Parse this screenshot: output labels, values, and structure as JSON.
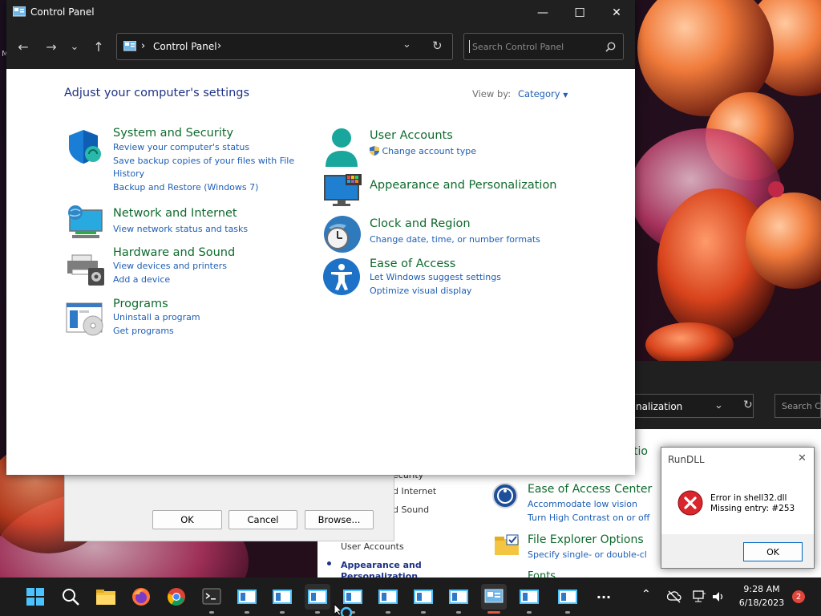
{
  "window": {
    "title": "Control Panel",
    "minimize": "—",
    "maximize": "☐",
    "close": "✕"
  },
  "nav": {
    "back": "←",
    "forward": "→",
    "recent": "⌄",
    "up": "↑",
    "breadcrumb_sep": "›",
    "address_text": "Control Panel",
    "address_end": "›",
    "dropdown": "⌄",
    "refresh": "↻",
    "search_placeholder": "Search Control Panel"
  },
  "content": {
    "heading": "Adjust your computer's settings",
    "view_by_label": "View by:",
    "view_by_value": "Category",
    "left_categories": [
      {
        "title": "System and Security",
        "icon": "shield-icon",
        "links": [
          "Review your computer's status",
          "Save backup copies of your files with File",
          "History",
          "Backup and Restore (Windows 7)"
        ]
      },
      {
        "title": "Network and Internet",
        "icon": "network-globe-icon",
        "links": [
          "View network status and tasks"
        ]
      },
      {
        "title": "Hardware and Sound",
        "icon": "printer-icon",
        "links": [
          "View devices and printers",
          "Add a device"
        ]
      },
      {
        "title": "Programs",
        "icon": "programs-disc-icon",
        "links": [
          "Uninstall a program",
          "Get programs"
        ]
      }
    ],
    "right_categories": [
      {
        "title": "User Accounts",
        "icon": "user-icon",
        "links": [
          "Change account type"
        ]
      },
      {
        "title": "Appearance and Personalization",
        "icon": "monitor-icon",
        "links": []
      },
      {
        "title": "Clock and Region",
        "icon": "clock-globe-icon",
        "links": [
          "Change date, time, or number formats"
        ]
      },
      {
        "title": "Ease of Access",
        "icon": "accessibility-icon",
        "links": [
          "Let Windows suggest settings",
          "Optimize visual display"
        ]
      }
    ]
  },
  "background": {
    "win2_address": "nalization",
    "win2_search": "Search C",
    "win2_partial_title": "tio",
    "win3_items": [
      "ecurity",
      "d Internet",
      "d Sound",
      "User Accounts",
      "Appearance and",
      "Personalization"
    ],
    "ease_title": "Ease of Access Center",
    "ease_links": [
      "Accommodate low vision",
      "Turn High Contrast on or off"
    ],
    "explorer_title": "File Explorer Options",
    "explorer_link": "Specify single- or double-cl",
    "fonts_title": "Fonts",
    "dialog_ok": "OK",
    "dialog_cancel": "Cancel",
    "dialog_browse": "Browse...",
    "left_edge_letter": "M"
  },
  "rundll": {
    "title": "RunDLL",
    "message_line1": "Error in shell32.dll",
    "message_line2": "Missing entry: #253",
    "ok": "OK",
    "close": "✕"
  },
  "taskbar": {
    "time": "9:28 AM",
    "date": "6/18/2023",
    "notification_count": "2",
    "overflow": "⌃",
    "more": "···"
  },
  "colors": {
    "link": "#1e5fb5",
    "category_title": "#0f6a2d",
    "heading": "#1e3287",
    "titlebar": "#202020",
    "taskbar": "#1c1c1c",
    "error_red": "#d9262c",
    "badge": "#e0463c"
  }
}
